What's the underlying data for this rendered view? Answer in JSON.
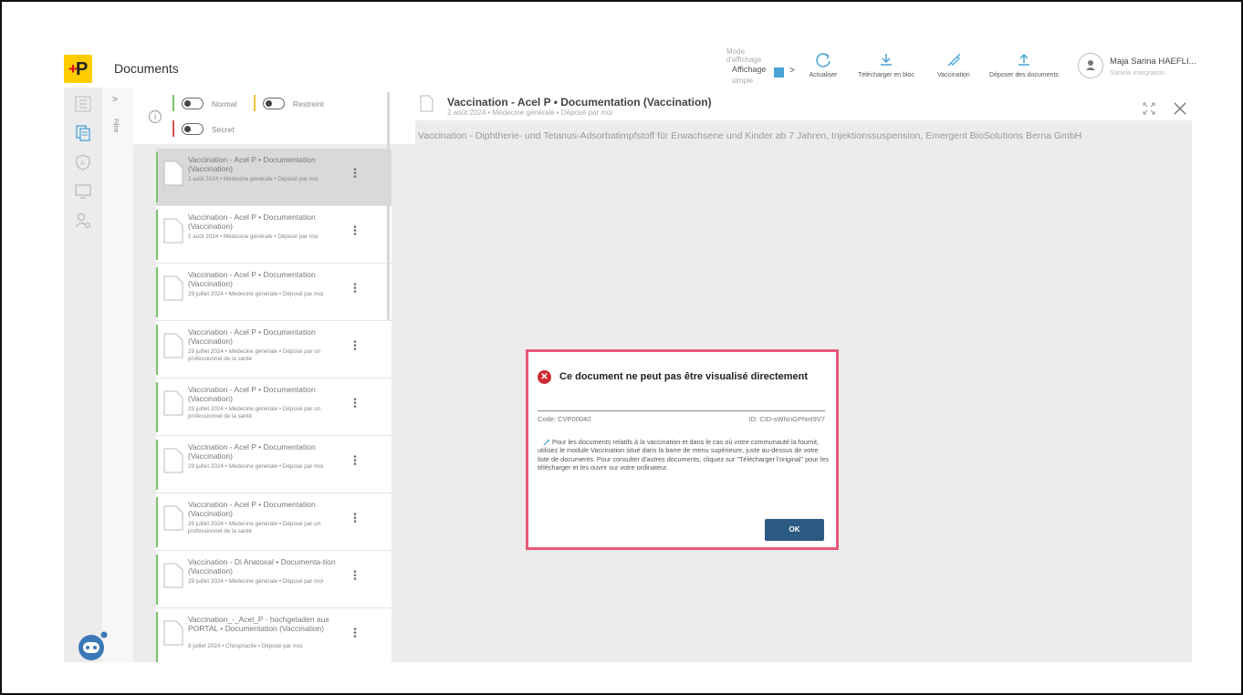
{
  "header": {
    "app_title": "Documents",
    "mode_label_1": "Mode",
    "mode_label_2": "d'affichage",
    "mode_value_1": "Affichage",
    "mode_value_2": "simple",
    "mode_chevron": ">",
    "tools": [
      {
        "label": "Actualiser",
        "icon": "refresh-icon"
      },
      {
        "label": "Télécharger en bloc",
        "icon": "download-icon"
      },
      {
        "label": "Vaccination",
        "icon": "syringe-icon"
      },
      {
        "label": "Déposer des documents",
        "icon": "upload-icon"
      }
    ],
    "user_name": "Maja Sarina HAEFLI...",
    "user_org": "Sanela Integration",
    "accent_color": "#4aa3d8"
  },
  "filters": {
    "collapse_arrow": ">",
    "filter_label": "Filtre",
    "normal": "Normal",
    "restreint": "Restreint",
    "secret": "Secret",
    "info": "i",
    "colors": {
      "normal": "#7ac36a",
      "restreint": "#f0c040",
      "secret": "#e05050"
    }
  },
  "documents": [
    {
      "title": "Vaccination - Acel P • Documentation (Vaccination)",
      "meta": "2 août 2024 • Médecine générale • Déposé par moi",
      "selected": true
    },
    {
      "title": "Vaccination - Acel P • Documentation (Vaccination)",
      "meta": "2 août 2024 • Médecine générale • Déposé par moi",
      "selected": false
    },
    {
      "title": "Vaccination - Acel P • Documentation (Vaccination)",
      "meta": "29 juillet 2024 • Médecine générale • Déposé par moi",
      "selected": false
    },
    {
      "title": "Vaccination - Acel P • Documentation (Vaccination)",
      "meta": "29 juillet 2024 • Médecine générale • Déposé par un professionnel de la santé",
      "selected": false
    },
    {
      "title": "Vaccination - Acel P • Documentation (Vaccination)",
      "meta": "29 juillet 2024 • Médecine générale • Déposé par un professionnel de la santé",
      "selected": false
    },
    {
      "title": "Vaccination - Acel P • Documentation (Vaccination)",
      "meta": "29 juillet 2024 • Médecine générale • Déposé par moi",
      "selected": false
    },
    {
      "title": "Vaccination - Acel P • Documentation (Vaccination)",
      "meta": "29 juillet 2024 • Médecine générale • Déposé par un professionnel de la santé",
      "selected": false
    },
    {
      "title": "Vaccination - Di Anatoxal • Documenta-tion (Vaccination)",
      "meta": "29 juillet 2024 • Médecine générale • Déposé par moi",
      "selected": false
    },
    {
      "title": "Vaccination_-_Acel_P - hochgeladen aus PORTAL • Documentation (Vaccination)",
      "meta": "8 juillet 2024 • Chiropractie • Déposé par moi",
      "selected": false
    }
  ],
  "preview": {
    "title": "Vaccination - Acel P • Documentation (Vaccination)",
    "subtitle": "2 août 2024 • Médecine générale • Déposé par moi",
    "description": "Vaccination - Diphtherie- und Tetanus-Adsorbatimpfstoff für Erwachsene und Kinder ab 7 Jahren, Injektionssuspension, Emergent BioSolutions Berna GmbH"
  },
  "modal": {
    "title": "Ce document ne peut pas être visualisé directement",
    "error_glyph": "✕",
    "code": "Code: CVP00040",
    "id": "ID: CID-sWNnGPNnI9V7",
    "body": "Pour les documents relatifs à la vaccination et dans le cas où votre communauté la fournit, utilisez le module Vaccination situé dans la barre de menu supérieure, juste au-dessus de votre liste de documents. Pour consulter d'autres documents, cliquez sur \"Télécharger l'original\" pour les télécharger et les ouvrir sur votre ordinateur.",
    "ok_label": "OK",
    "border_color": "#e85a78",
    "button_color": "#2a5a82"
  }
}
